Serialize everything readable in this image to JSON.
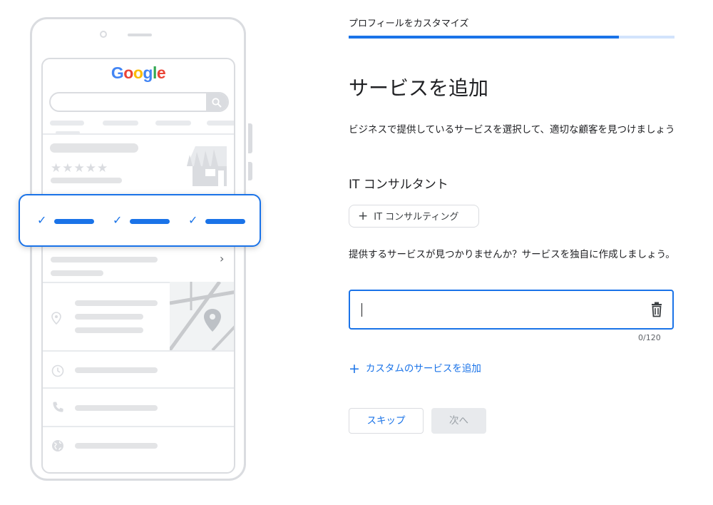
{
  "illustration": {
    "logo_letters": [
      {
        "ch": "G",
        "color": "#4285F4"
      },
      {
        "ch": "o",
        "color": "#EA4335"
      },
      {
        "ch": "o",
        "color": "#FBBC05"
      },
      {
        "ch": "g",
        "color": "#4285F4"
      },
      {
        "ch": "l",
        "color": "#34A853"
      },
      {
        "ch": "e",
        "color": "#EA4335"
      }
    ],
    "rating_stars": "★★★★★"
  },
  "progress": {
    "label": "プロフィールをカスタマイズ",
    "fraction": 0.83
  },
  "main": {
    "title": "サービスを追加",
    "description": "ビジネスで提供しているサービスを選択して、適切な顧客を見つけましょう",
    "category": "IT コンサルタント",
    "suggestion_chip": "IT コンサルティング",
    "custom_prompt": "提供するサービスが見つかりませんか？サービスを独自に作成しましょう。",
    "custom_input": {
      "value": "",
      "placeholder": ""
    },
    "char_counter": "0/120",
    "add_custom_label": "カスタムのサービスを追加"
  },
  "buttons": {
    "skip": "スキップ",
    "next": "次へ"
  },
  "colors": {
    "accent": "#1a73e8",
    "progress_track": "#d2e3fc",
    "placeholder_gray": "#e3e4e6"
  }
}
